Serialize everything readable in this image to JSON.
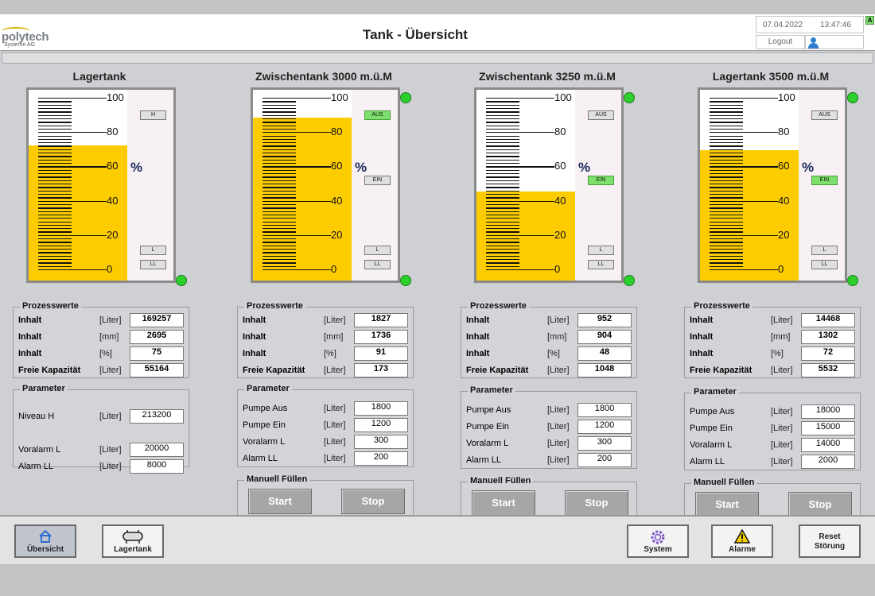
{
  "header": {
    "logo_brand": "polytech",
    "logo_sub": "Systeme AG",
    "title": "Tank - Übersicht",
    "date": "07.04.2022",
    "time": "13:47:46",
    "logout_label": "Logout",
    "alarm_indicator": "A"
  },
  "scale_labels": [
    "100",
    "80",
    "60",
    "40",
    "20",
    "0"
  ],
  "percent_symbol": "%",
  "group_labels": {
    "process": "Prozesswerte",
    "params": "Parameter",
    "manual": "Manuell Füllen"
  },
  "buttons": {
    "start": "Start",
    "stop": "Stop"
  },
  "tanks": [
    {
      "title": "Lagertank",
      "level_percent": 75,
      "markers": [
        {
          "label": "H",
          "active": false
        },
        {
          "label": "L",
          "active": false
        },
        {
          "label": "LL",
          "active": false
        }
      ],
      "process": [
        {
          "label": "Inhalt",
          "unit": "[Liter]",
          "value": "169257"
        },
        {
          "label": "Inhalt",
          "unit": "[mm]",
          "value": "2695"
        },
        {
          "label": "Inhalt",
          "unit": "[%]",
          "value": "75"
        },
        {
          "label": "Freie Kapazität",
          "unit": "[Liter]",
          "value": "55164"
        }
      ],
      "params": [
        {
          "label": "Niveau H",
          "unit": "[Liter]",
          "value": "213200"
        },
        {
          "label": "Voralarm L",
          "unit": "[Liter]",
          "value": "20000"
        },
        {
          "label": "Alarm LL",
          "unit": "[Liter]",
          "value": "8000"
        }
      ]
    },
    {
      "title": "Zwischentank 3000 m.ü.M",
      "level_percent": 91,
      "markers": [
        {
          "label": "AUS",
          "active": true
        },
        {
          "label": "EIN",
          "active": false
        },
        {
          "label": "L",
          "active": false
        },
        {
          "label": "LL",
          "active": false
        }
      ],
      "process": [
        {
          "label": "Inhalt",
          "unit": "[Liter]",
          "value": "1827"
        },
        {
          "label": "Inhalt",
          "unit": "[mm]",
          "value": "1736"
        },
        {
          "label": "Inhalt",
          "unit": "[%]",
          "value": "91"
        },
        {
          "label": "Freie Kapazität",
          "unit": "[Liter]",
          "value": "173"
        }
      ],
      "params": [
        {
          "label": "Pumpe Aus",
          "unit": "[Liter]",
          "value": "1800"
        },
        {
          "label": "Pumpe Ein",
          "unit": "[Liter]",
          "value": "1200"
        },
        {
          "label": "Voralarm L",
          "unit": "[Liter]",
          "value": "300"
        },
        {
          "label": "Alarm LL",
          "unit": "[Liter]",
          "value": "200"
        }
      ]
    },
    {
      "title": "Zwischentank 3250 m.ü.M",
      "level_percent": 48,
      "markers": [
        {
          "label": "AUS",
          "active": false
        },
        {
          "label": "EIN",
          "active": true
        },
        {
          "label": "L",
          "active": false
        },
        {
          "label": "LL",
          "active": false
        }
      ],
      "process": [
        {
          "label": "Inhalt",
          "unit": "[Liter]",
          "value": "952"
        },
        {
          "label": "Inhalt",
          "unit": "[mm]",
          "value": "904"
        },
        {
          "label": "Inhalt",
          "unit": "[%]",
          "value": "48"
        },
        {
          "label": "Freie Kapazität",
          "unit": "[Liter]",
          "value": "1048"
        }
      ],
      "params": [
        {
          "label": "Pumpe Aus",
          "unit": "[Liter]",
          "value": "1800"
        },
        {
          "label": "Pumpe Ein",
          "unit": "[Liter]",
          "value": "1200"
        },
        {
          "label": "Voralarm L",
          "unit": "[Liter]",
          "value": "300"
        },
        {
          "label": "Alarm LL",
          "unit": "[Liter]",
          "value": "200"
        }
      ]
    },
    {
      "title": "Lagertank 3500 m.ü.M",
      "level_percent": 72,
      "markers": [
        {
          "label": "AUS",
          "active": false
        },
        {
          "label": "EIN",
          "active": true
        },
        {
          "label": "L",
          "active": false
        },
        {
          "label": "LL",
          "active": false
        }
      ],
      "process": [
        {
          "label": "Inhalt",
          "unit": "[Liter]",
          "value": "14468"
        },
        {
          "label": "Inhalt",
          "unit": "[mm]",
          "value": "1302"
        },
        {
          "label": "Inhalt",
          "unit": "[%]",
          "value": "72"
        },
        {
          "label": "Freie Kapazität",
          "unit": "[Liter]",
          "value": "5532"
        }
      ],
      "params": [
        {
          "label": "Pumpe Aus",
          "unit": "[Liter]",
          "value": "18000"
        },
        {
          "label": "Pumpe Ein",
          "unit": "[Liter]",
          "value": "15000"
        },
        {
          "label": "Voralarm L",
          "unit": "[Liter]",
          "value": "14000"
        },
        {
          "label": "Alarm LL",
          "unit": "[Liter]",
          "value": "2000"
        }
      ]
    }
  ],
  "footer": {
    "overview": "Übersicht",
    "storage": "Lagertank",
    "system": "System",
    "alarms": "Alarme",
    "reset_line1": "Reset",
    "reset_line2": "Störung"
  },
  "colors": {
    "fill": "#fccc00",
    "led_ok": "#2bd02b",
    "marker_active": "#7ee06c"
  }
}
